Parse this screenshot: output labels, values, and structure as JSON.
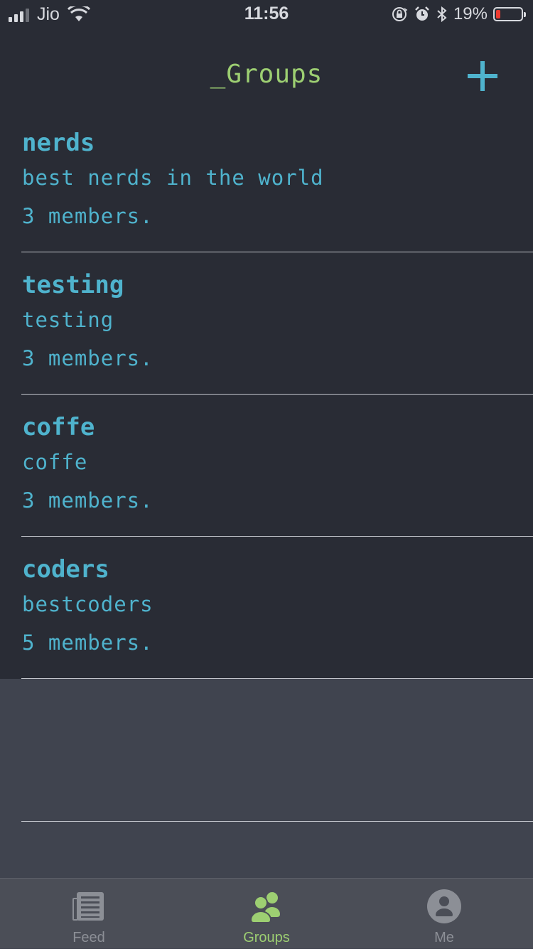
{
  "status_bar": {
    "carrier": "Jio",
    "time": "11:56",
    "battery_percent": "19%",
    "battery_level": 0.19,
    "icons": [
      "signal-icon",
      "wifi-icon",
      "orientation-lock-icon",
      "alarm-icon",
      "bluetooth-icon",
      "battery-icon"
    ]
  },
  "header": {
    "title": "_Groups",
    "add_icon": "plus-icon"
  },
  "groups": [
    {
      "name": "nerds",
      "description": "best nerds in the world",
      "members": "3 members."
    },
    {
      "name": "testing",
      "description": "testing",
      "members": "3 members."
    },
    {
      "name": "coffe",
      "description": "coffe",
      "members": "3 members."
    },
    {
      "name": "coders",
      "description": "bestcoders",
      "members": "5 members."
    }
  ],
  "tab_bar": {
    "tabs": [
      {
        "label": "Feed",
        "icon": "newspaper-icon",
        "active": false
      },
      {
        "label": "Groups",
        "icon": "people-icon",
        "active": true
      },
      {
        "label": "Me",
        "icon": "user-icon",
        "active": false
      }
    ]
  },
  "colors": {
    "background": "#292c35",
    "empty_area": "#40444f",
    "accent_green": "#9dcf72",
    "accent_blue": "#4fb3cd",
    "tab_inactive": "#8c8f96"
  }
}
